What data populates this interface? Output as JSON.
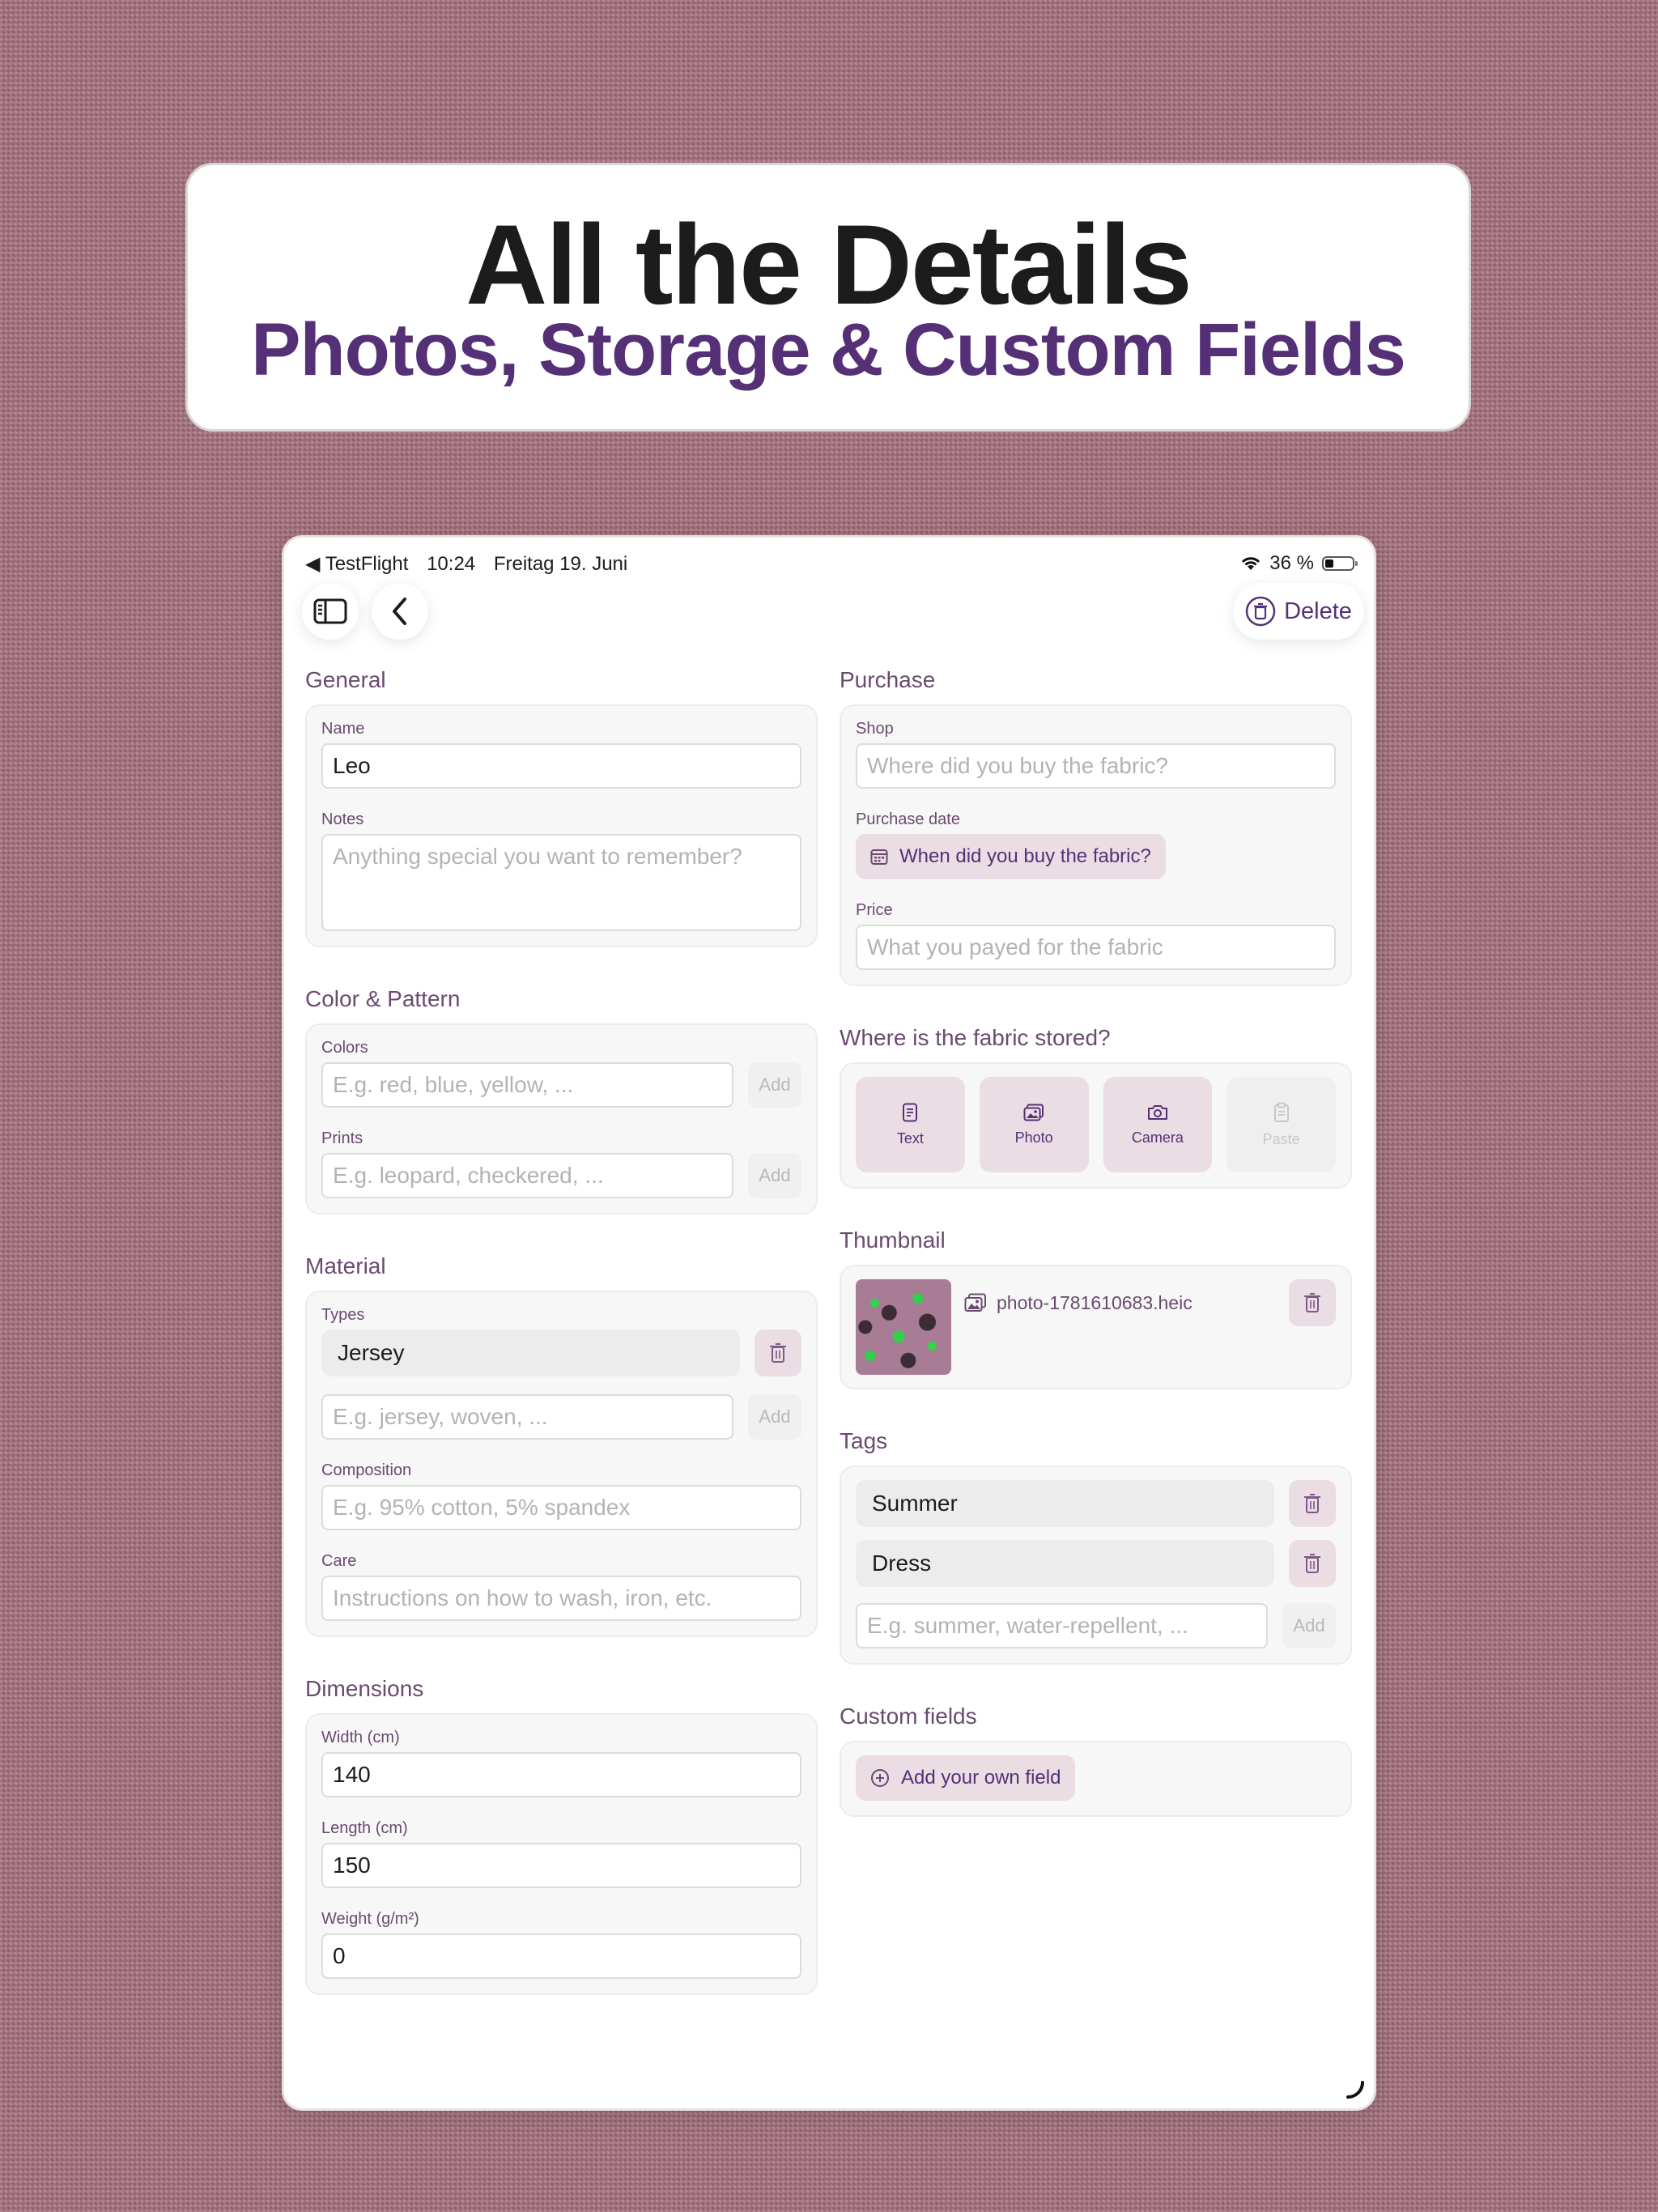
{
  "banner": {
    "title": "All the Details",
    "subtitle": "Photos, Storage & Custom Fields"
  },
  "status_bar": {
    "back_app": "◀ TestFlight",
    "time": "10:24",
    "date": "Freitag 19. Juni",
    "battery": "36 %"
  },
  "nav": {
    "delete_label": "Delete"
  },
  "general": {
    "title": "General",
    "name_label": "Name",
    "name_value": "Leo",
    "notes_label": "Notes",
    "notes_placeholder": "Anything special you want to remember?"
  },
  "color_pattern": {
    "title": "Color & Pattern",
    "colors_label": "Colors",
    "colors_placeholder": "E.g. red, blue, yellow, ...",
    "prints_label": "Prints",
    "prints_placeholder": "E.g. leopard, checkered, ...",
    "add_label": "Add"
  },
  "material": {
    "title": "Material",
    "types_label": "Types",
    "types": [
      "Jersey"
    ],
    "types_placeholder": "E.g. jersey, woven, ...",
    "add_label": "Add",
    "composition_label": "Composition",
    "composition_placeholder": "E.g. 95% cotton, 5% spandex",
    "care_label": "Care",
    "care_placeholder": "Instructions on how to wash, iron, etc."
  },
  "dimensions": {
    "title": "Dimensions",
    "width_label": "Width (cm)",
    "width_value": "140",
    "length_label": "Length (cm)",
    "length_value": "150",
    "weight_label": "Weight (g/m²)",
    "weight_value": "0"
  },
  "purchase": {
    "title": "Purchase",
    "shop_label": "Shop",
    "shop_placeholder": "Where did you buy the fabric?",
    "date_label": "Purchase date",
    "date_button": "When did you buy the fabric?",
    "price_label": "Price",
    "price_placeholder": "What you payed for the fabric"
  },
  "storage": {
    "title": "Where is the fabric stored?",
    "options": [
      {
        "label": "Text",
        "icon": "document-icon"
      },
      {
        "label": "Photo",
        "icon": "photo-icon"
      },
      {
        "label": "Camera",
        "icon": "camera-icon"
      },
      {
        "label": "Paste",
        "icon": "clipboard-icon"
      }
    ]
  },
  "thumbnail": {
    "title": "Thumbnail",
    "filename": "photo-1781610683.heic"
  },
  "tags": {
    "title": "Tags",
    "items": [
      "Summer",
      "Dress"
    ],
    "placeholder": "E.g. summer, water-repellent, ...",
    "add_label": "Add"
  },
  "custom_fields": {
    "title": "Custom fields",
    "add_label": "Add your own field"
  },
  "colors": {
    "accent": "#553077",
    "label": "#6b4a70",
    "chip_tint": "#eadde4"
  }
}
